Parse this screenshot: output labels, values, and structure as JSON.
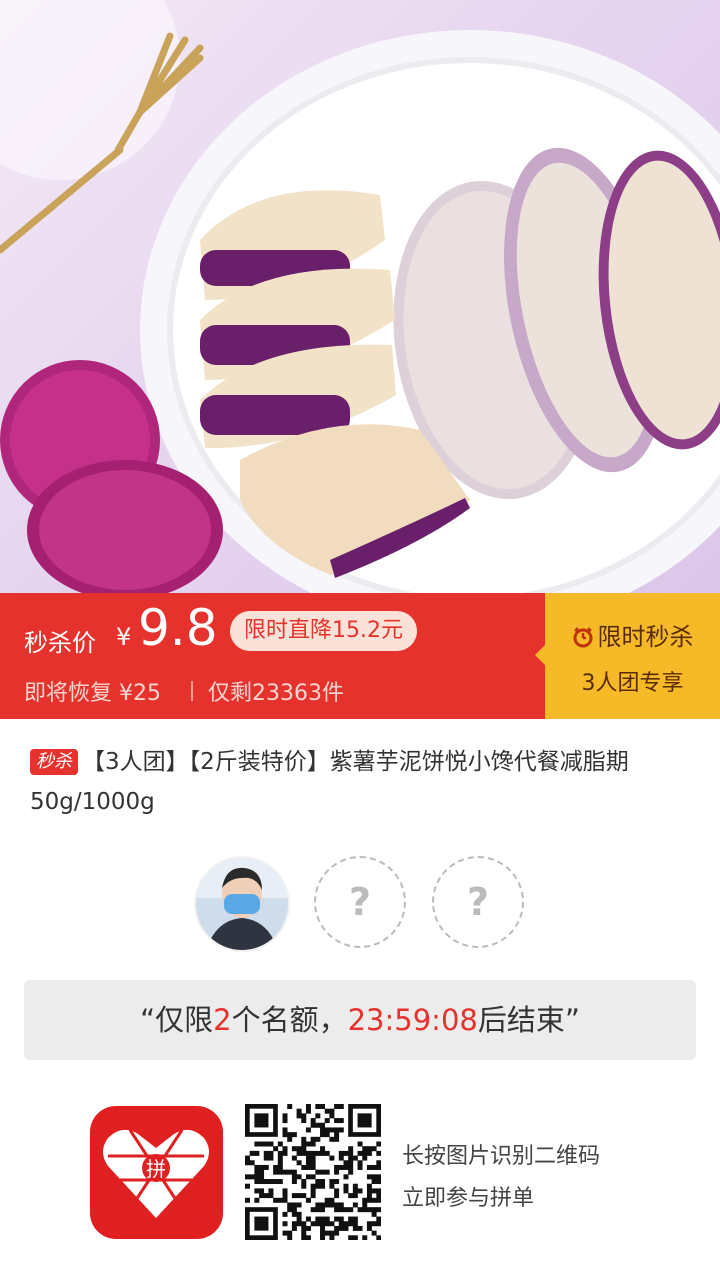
{
  "price_banner": {
    "seckill_label": "秒杀价",
    "currency": "¥",
    "price": "9.8",
    "drop_tag": "限时直降15.2元",
    "restore_text": "即将恢复 ¥25",
    "remain_text": "仅剩23363件",
    "limited_label": "限时秒杀",
    "group_label": "3人团专享",
    "colors": {
      "red": "#e5322d",
      "yellow": "#f6b928"
    }
  },
  "product": {
    "tag": "秒杀",
    "title": "【3人团】【2斤装特价】紫薯芋泥饼悦小馋代餐减脂期50g/1000g"
  },
  "group": {
    "empty_slot_symbol": "?",
    "quota_prefix": "“仅限",
    "quota_count": "2",
    "quota_mid": "个名额，",
    "countdown": "23:59:08",
    "quota_suffix": "后结束”"
  },
  "footer": {
    "hint_line1": "长按图片识别二维码",
    "hint_line2": "立即参与拼单",
    "logo_icon": "pinduoduo-logo-icon",
    "qr_icon": "qr-code-icon",
    "logo_text": "拼"
  }
}
